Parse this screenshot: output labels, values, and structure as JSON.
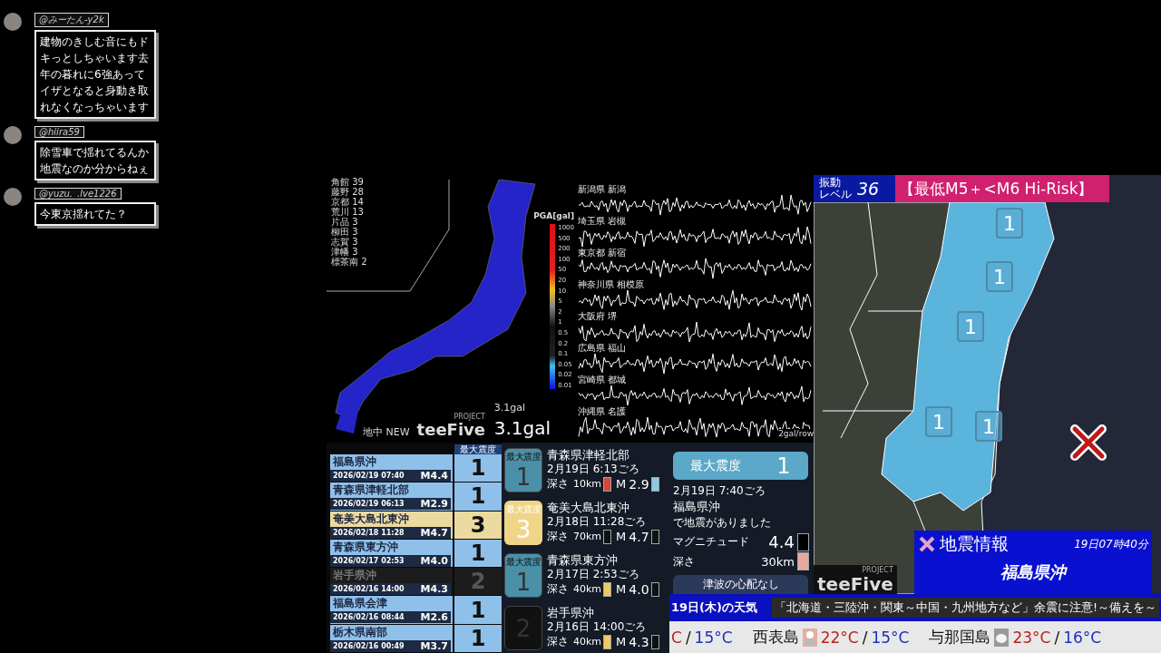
{
  "chat": [
    {
      "user": "@みーたん-y2k",
      "message": "建物のきしむ音にもドキっとしちゃいます去年の暮れに6強あってイザとなると身動き取れなくなっちゃいます"
    },
    {
      "user": "@hiira59",
      "message": "除雪車で揺れてるんか地震なのか分からねぇ"
    },
    {
      "user": "@yuzu._.lve1226",
      "message": "今東京揺れてた？"
    }
  ],
  "pga_map": {
    "station_counts": [
      "角館 39",
      "藤野 28",
      "京都 14",
      "荒川 13",
      "片品 3",
      "柳田 3",
      "志賀 3",
      "津幡 3",
      "標茶南 2"
    ],
    "scale_title": "PGA[gal]",
    "scale_labels": [
      "1000",
      "500",
      "200",
      "100",
      "50",
      "20",
      "10",
      "5",
      "2",
      "1",
      "0.5",
      "0.2",
      "0.1",
      "0.05",
      "0.02",
      "0.01"
    ],
    "small_reading": "3.1gal",
    "reading": "3.1gal",
    "label": "地中 NEW",
    "logo": "teeFive",
    "logo_sub": "PROJECT"
  },
  "waveforms": {
    "stations": [
      "新潟県 新潟",
      "埼玉県 岩槻",
      "東京都 新宿",
      "神奈川県 相模原",
      "大阪府 堺",
      "広島県 福山",
      "宮崎県 都城",
      "沖縄県 名護"
    ],
    "scale": "2gal/row"
  },
  "history_header": "最大震度",
  "history": [
    {
      "region": "福島県沖",
      "datetime": "2026/02/19 07:40",
      "magnitude": "M4.4",
      "intensity": "1",
      "color": "#8fc0ea"
    },
    {
      "region": "青森県津軽北部",
      "datetime": "2026/02/19 06:13",
      "magnitude": "M2.9",
      "intensity": "1",
      "color": "#8fc0ea"
    },
    {
      "region": "奄美大島北東沖",
      "datetime": "2026/02/18 11:28",
      "magnitude": "M4.7",
      "intensity": "3",
      "color": "#ecd9a0"
    },
    {
      "region": "青森県東方沖",
      "datetime": "2026/02/17 02:53",
      "magnitude": "M4.0",
      "intensity": "1",
      "color": "#8fc0ea"
    },
    {
      "region": "岩手県沖",
      "datetime": "2026/02/16 14:00",
      "magnitude": "M4.3",
      "intensity": "2",
      "color": "#1c1c1c"
    },
    {
      "region": "福島県会津",
      "datetime": "2026/02/16 08:44",
      "magnitude": "M2.6",
      "intensity": "1",
      "color": "#8fc0ea"
    },
    {
      "region": "栃木県南部",
      "datetime": "2026/02/16 00:49",
      "magnitude": "M3.7",
      "intensity": "1",
      "color": "#8fc0ea"
    }
  ],
  "recent": [
    {
      "badge_label": "最大震度",
      "intensity": "1",
      "color": "#4a90a8",
      "region": "青森県津軽北部",
      "time": "2月19日 6:13ごろ",
      "depth_label": "深さ",
      "depth": {
        "value": "10km",
        "color": "#d9453a"
      },
      "magnitude_label": "M",
      "magnitude": {
        "value": "2.9",
        "color": "#8ec8e0"
      }
    },
    {
      "badge_label": "最大震度",
      "intensity": "3",
      "color": "#f0d488",
      "region": "奄美大島北東沖",
      "time": "2月18日 11:28ごろ",
      "depth_label": "深さ",
      "depth": {
        "value": "70km",
        "color": "#111111"
      },
      "magnitude_label": "M",
      "magnitude": {
        "value": "4.7",
        "color": "#111111"
      }
    },
    {
      "badge_label": "最大震度",
      "intensity": "1",
      "color": "#4a90a8",
      "region": "青森県東方沖",
      "time": "2月17日 2:53ごろ",
      "depth_label": "深さ",
      "depth": {
        "value": "40km",
        "color": "#f0c860"
      },
      "magnitude_label": "M",
      "magnitude": {
        "value": "4.0",
        "color": "#111111"
      }
    },
    {
      "intensity": "2",
      "color": "#111111",
      "region": "岩手県沖",
      "time": "2月16日 14:00ごろ",
      "depth_label": "深さ",
      "depth": {
        "value": "40km",
        "color": "#f0c860"
      },
      "magnitude_label": "M",
      "magnitude": {
        "value": "4.3",
        "color": "#111111"
      }
    }
  ],
  "detail": {
    "label": "最大震度",
    "intensity": "1",
    "time": "2月19日 7:40ごろ",
    "region": "福島県沖",
    "note": "で地震がありました",
    "magnitude_label": "マグニチュード",
    "magnitude": {
      "value": "4.4",
      "color": "#000000"
    },
    "depth_label": "深さ",
    "depth": {
      "value": "30km",
      "color": "#e8a8a0"
    },
    "tsunami": "津波の心配なし"
  },
  "shaking": {
    "label_top": "振動",
    "label_bottom": "レベル",
    "value": "36"
  },
  "risk_banner": "【最低M5＋<M6 Hi-Risk】",
  "map_markers": [
    "1",
    "1",
    "1",
    "1",
    "1"
  ],
  "map_logo": "teeFive",
  "map_logo_sub": "PROJECT",
  "quake_info": {
    "title": "地震情報",
    "time": "19日07時40分",
    "region": "福島県沖"
  },
  "ticker": {
    "label": "19日(木)の天気",
    "headline": "「北海道・三陸沖・関東～中国・九州地方など」余震に注意!～備えを～"
  },
  "weather": [
    {
      "high": "C",
      "separator": "/",
      "low": "15°C"
    },
    {
      "place": "西表島",
      "kind": "sun-cloud",
      "high": "22°C",
      "separator": "/",
      "low": "15°C"
    },
    {
      "place": "与那国島",
      "kind": "cloud",
      "high": "23°C",
      "separator": "/",
      "low": "16°C"
    }
  ]
}
